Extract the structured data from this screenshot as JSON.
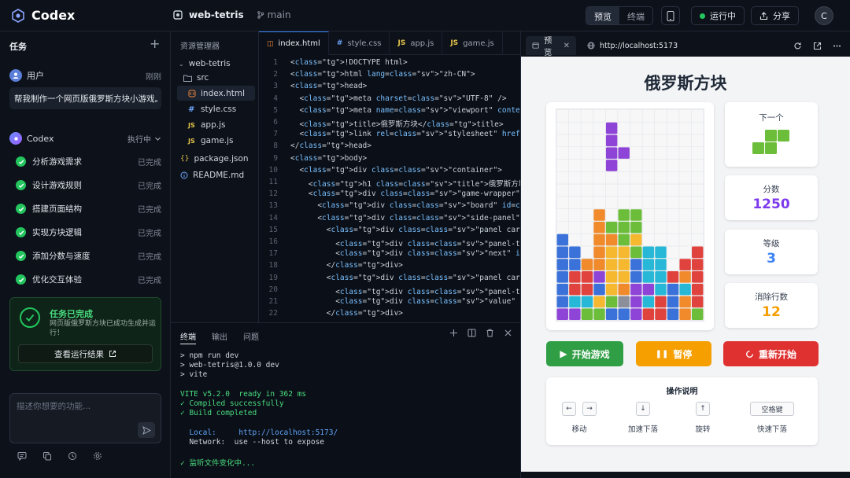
{
  "app": {
    "name": "Codex",
    "project": "web-tetris",
    "branch": "main"
  },
  "topbar": {
    "view_preview": "预览",
    "view_terminal": "终端",
    "run_status": "运行中",
    "share": "分享",
    "avatar": "C"
  },
  "left": {
    "title": "任务",
    "user_name": "用户",
    "user_time": "刚刚",
    "user_message": "帮我制作一个网页版俄罗斯方块小游戏。",
    "agent_name": "Codex",
    "agent_status": "执行中",
    "steps": [
      {
        "label": "分析游戏需求",
        "status": "已完成"
      },
      {
        "label": "设计游戏规则",
        "status": "已完成"
      },
      {
        "label": "搭建页面结构",
        "status": "已完成"
      },
      {
        "label": "实现方块逻辑",
        "status": "已完成"
      },
      {
        "label": "添加分数与速度",
        "status": "已完成"
      },
      {
        "label": "优化交互体验",
        "status": "已完成"
      }
    ],
    "done_title": "任务已完成",
    "done_desc": "网页版俄罗斯方块已成功生成并运行！",
    "result_button": "查看运行结果",
    "input_placeholder": "描述你想要的功能..."
  },
  "explorer": {
    "title": "资源管理器",
    "items": [
      "web-tetris",
      "src",
      "index.html",
      "style.css",
      "app.js",
      "game.js",
      "package.json",
      "README.md"
    ]
  },
  "editor": {
    "tabs": [
      {
        "icon": "◫",
        "label": "index.html"
      },
      {
        "icon": "#",
        "label": "style.css"
      },
      {
        "icon": "JS",
        "label": "app.js"
      },
      {
        "icon": "JS",
        "label": "game.js"
      }
    ],
    "lines": [
      "<!DOCTYPE html>",
      "<html lang=\"zh-CN\">",
      "<head>",
      "  <meta charset=\"UTF-8\" />",
      "  <meta name=\"viewport\" content=\"width=device-width, i",
      "  <title>俄罗斯方块</title>",
      "  <link rel=\"stylesheet\" href=\"style.css\" />",
      "</head>",
      "<body>",
      "  <div class=\"container\">",
      "    <h1 class=\"title\">俄罗斯方块</h1>",
      "    <div class=\"game-wrapper\">",
      "      <div class=\"board\" id=\"board\"></div>",
      "      <div class=\"side-panel\">",
      "        <div class=\"panel card\">",
      "          <div class=\"panel-title\">下一个</div>",
      "          <div class=\"next\" id=\"next\"></div>",
      "        </div>",
      "        <div class=\"panel card\">",
      "          <div class=\"panel-title\">分数</div>",
      "          <div class=\"value\" id=\"score\">0</div>",
      "        </div>"
    ]
  },
  "terminal": {
    "tabs": [
      "终端",
      "输出",
      "问题"
    ],
    "lines": [
      {
        "text": "> npm run dev",
        "cls": ""
      },
      {
        "text": "> web-tetris@1.0.0 dev",
        "cls": ""
      },
      {
        "text": "> vite",
        "cls": ""
      },
      {
        "text": "",
        "cls": ""
      },
      {
        "text": "VITE v5.2.0  ready in 362 ms",
        "cls": "green"
      },
      {
        "text": "✓ Compiled successfully",
        "cls": "green"
      },
      {
        "text": "✓ Build completed",
        "cls": "green"
      },
      {
        "text": "",
        "cls": ""
      },
      {
        "text": "  Local:     http://localhost:5173/",
        "cls": "link"
      },
      {
        "text": "  Network:  use --host to expose",
        "cls": ""
      },
      {
        "text": "",
        "cls": ""
      },
      {
        "text": "✓ 监听文件变化中...",
        "cls": "green"
      }
    ]
  },
  "preview": {
    "tab": "预览",
    "url": "http://localhost:5173",
    "game_title": "俄罗斯方块",
    "next_label": "下一个",
    "score_label": "分数",
    "score": "1250",
    "level_label": "等级",
    "level": "3",
    "lines_label": "消除行数",
    "lines": "12",
    "btn_start": "开始游戏",
    "btn_pause": "暂停",
    "btn_restart": "重新开始",
    "controls_title": "操作说明",
    "controls": [
      {
        "keys": [
          "←",
          "→"
        ],
        "label": "移动"
      },
      {
        "keys": [
          "↓"
        ],
        "label": "加速下落"
      },
      {
        "keys": [
          "↑"
        ],
        "label": "旋转"
      },
      {
        "keys": [
          "空格键"
        ],
        "label": "快速下落"
      }
    ],
    "colors": {
      "start": "#2f9e44",
      "pause": "#f59f00",
      "restart": "#e03131",
      "score": "#7c3aed",
      "level": "#3b82f6",
      "lines": "#f59f00"
    }
  }
}
